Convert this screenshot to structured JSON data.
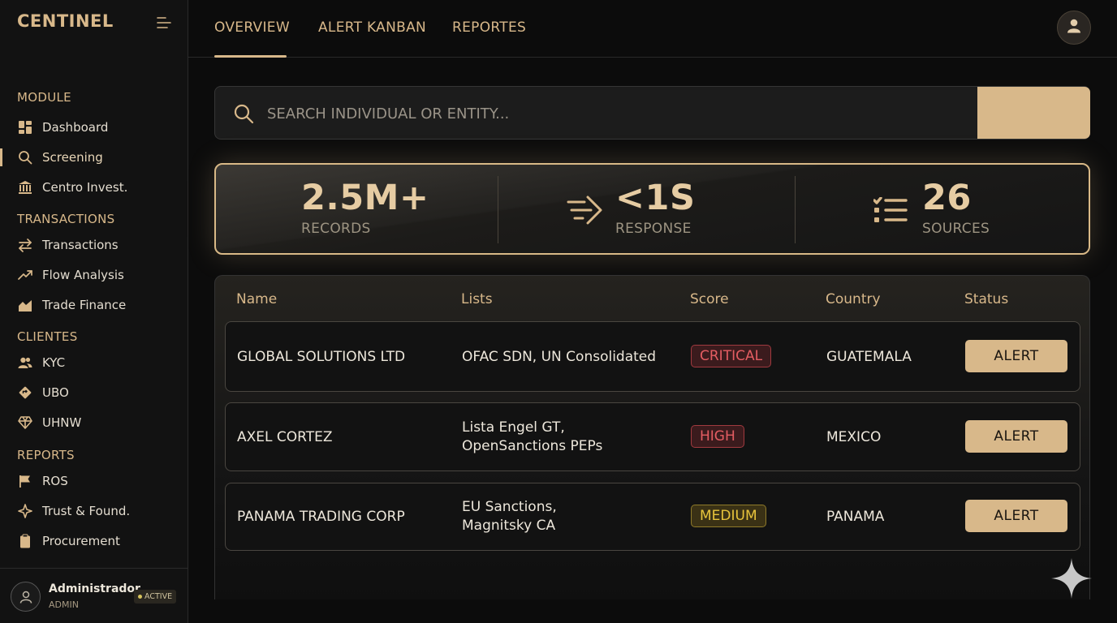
{
  "brand": "CENTINEL",
  "sidebar": {
    "sections": [
      {
        "label": "MODULE"
      },
      {
        "label": "TRANSACTIONS"
      },
      {
        "label": "CLIENTES"
      },
      {
        "label": "REPORTS"
      }
    ],
    "items": [
      {
        "label": "Dashboard",
        "icon": "dashboard-icon"
      },
      {
        "label": "Screening",
        "icon": "search-icon",
        "active": true
      },
      {
        "label": "Centro Invest.",
        "icon": "bank-icon"
      },
      {
        "label": "Transactions",
        "icon": "swap-icon"
      },
      {
        "label": "Flow Analysis",
        "icon": "trend-icon"
      },
      {
        "label": "Trade Finance",
        "icon": "chart-area-icon"
      },
      {
        "label": "KYC",
        "icon": "users-icon"
      },
      {
        "label": "UBO",
        "icon": "diamond-direction-icon"
      },
      {
        "label": "UHNW",
        "icon": "gem-icon"
      },
      {
        "label": "ROS",
        "icon": "flag-icon"
      },
      {
        "label": "Trust & Found.",
        "icon": "sparkle-icon"
      },
      {
        "label": "Procurement",
        "icon": "clipboard-icon"
      }
    ],
    "user": {
      "name": "Administrador",
      "role": "ADMIN",
      "status": "ACTIVE"
    }
  },
  "header": {
    "tabs": [
      {
        "label": "OVERVIEW",
        "active": true
      },
      {
        "label": "ALERT KANBAN"
      },
      {
        "label": "REPORTES"
      }
    ]
  },
  "search": {
    "placeholder": "SEARCH INDIVIDUAL OR ENTITY...",
    "value": ""
  },
  "stats": [
    {
      "value": "2.5M+",
      "label": "RECORDS"
    },
    {
      "value": "<1S",
      "label": "RESPONSE",
      "icon": "speed-arrow-icon"
    },
    {
      "value": "26",
      "label": "SOURCES",
      "icon": "list-icon"
    }
  ],
  "table": {
    "columns": [
      "Name",
      "Lists",
      "Score",
      "Country",
      "Status"
    ],
    "rows": [
      {
        "name": "GLOBAL SOLUTIONS LTD",
        "lists": [
          "OFAC SDN, UN Consolidated"
        ],
        "score": "CRITICAL",
        "country": "GUATEMALA",
        "action": "ALERT"
      },
      {
        "name": "AXEL CORTEZ",
        "lists": [
          "Lista Engel GT,",
          "OpenSanctions PEPs"
        ],
        "score": "HIGH",
        "country": "MEXICO",
        "action": "ALERT"
      },
      {
        "name": "PANAMA TRADING CORP",
        "lists": [
          "EU Sanctions,",
          "Magnitsky CA"
        ],
        "score": "MEDIUM",
        "country": "PANAMA",
        "action": "ALERT"
      }
    ]
  },
  "colors": {
    "accent": "#d8b88a",
    "critical": "#e45d62",
    "medium": "#e8c43c",
    "background": "#0c0c0c"
  }
}
